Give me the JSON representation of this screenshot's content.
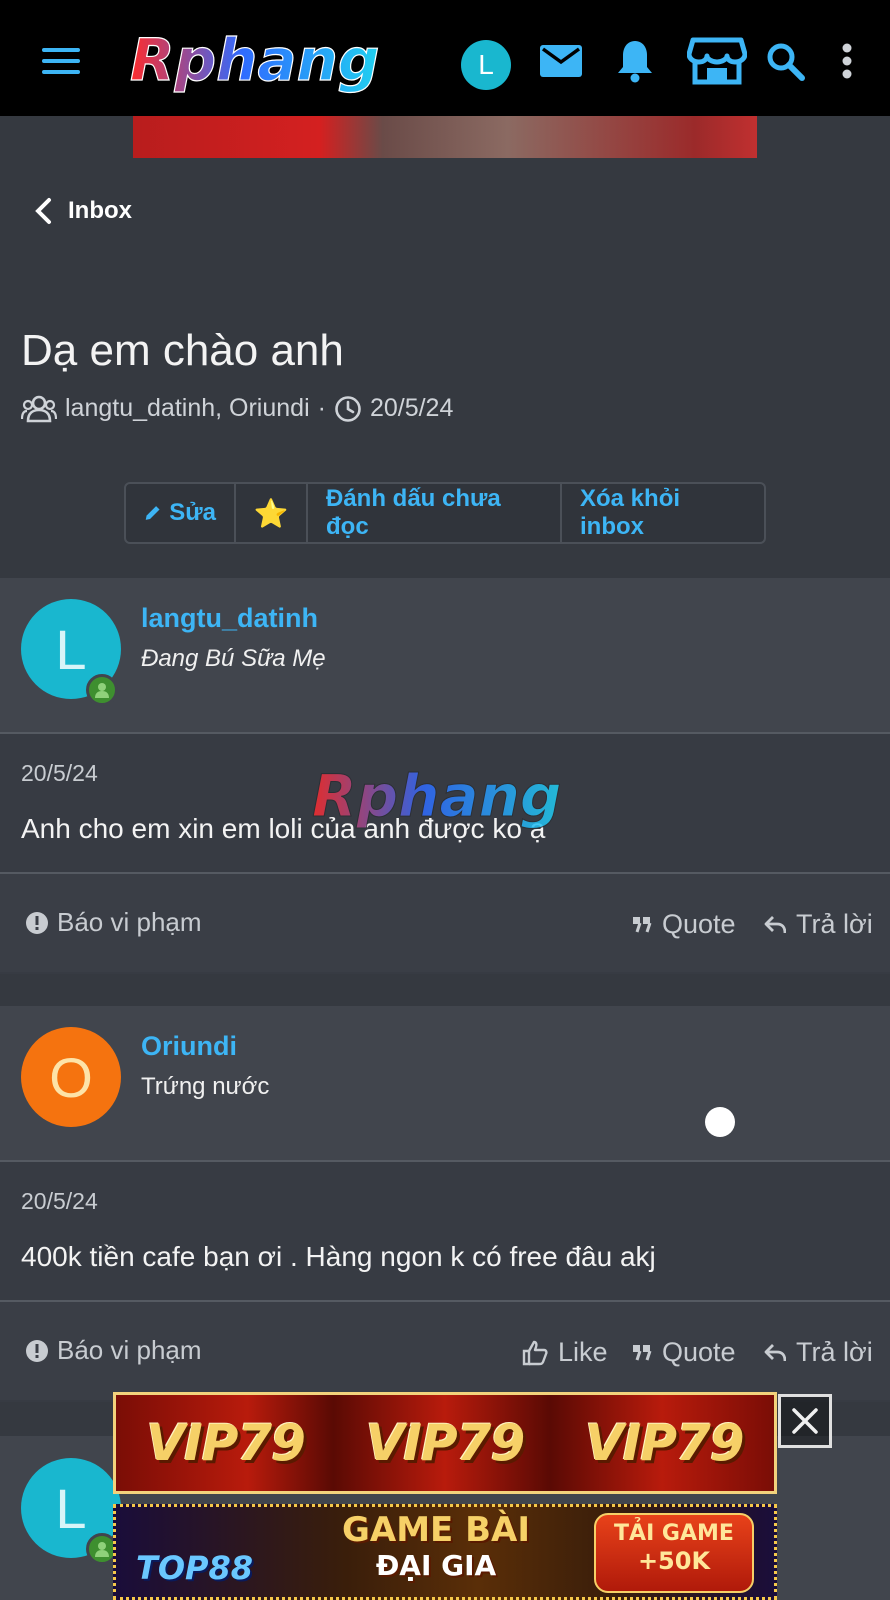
{
  "app": {
    "logo_text": "Rphang",
    "user_initial": "L"
  },
  "nav": {
    "back_label": "Inbox"
  },
  "conversation": {
    "title": "Dạ em chào anh",
    "participants": "langtu_datinh, Oriundi",
    "separator": "·",
    "date": "20/5/24"
  },
  "actions": {
    "edit_label": "Sửa",
    "star_glyph": "⭐",
    "mark_unread_label": "Đánh dấu chưa đọc",
    "remove_label": "Xóa khỏi inbox"
  },
  "messages": [
    {
      "initial": "L",
      "avatar_color": "#19b7cf",
      "username": "langtu_datinh",
      "user_title": "Đang Bú Sữa Mẹ",
      "date": "20/5/24",
      "text": "Anh cho em xin em loli của anh được ko ạ",
      "report_label": "Báo vi phạm",
      "quote_label": "Quote",
      "reply_label": "Trả lời"
    },
    {
      "initial": "O",
      "avatar_color": "#f5730f",
      "username": "Oriundi",
      "user_title": "Trứng nước",
      "date": "20/5/24",
      "text": "400k tiền cafe bạn ơi . Hàng ngon k có free đâu akj",
      "report_label": "Báo vi phạm",
      "like_label": "Like",
      "quote_label": "Quote",
      "reply_label": "Trả lời"
    },
    {
      "initial": "L",
      "avatar_color": "#19b7cf"
    }
  ],
  "ads": {
    "vip_text": "VIP79",
    "top88_text": "TOP88",
    "game_bai": "GAME BÀI",
    "dai_gia": "ĐẠI GIA",
    "tai_game": "TẢI GAME",
    "bonus": "+50K"
  },
  "colors": {
    "accent": "#3db5f5",
    "online": "#3e8f2f",
    "background": "#353940"
  }
}
